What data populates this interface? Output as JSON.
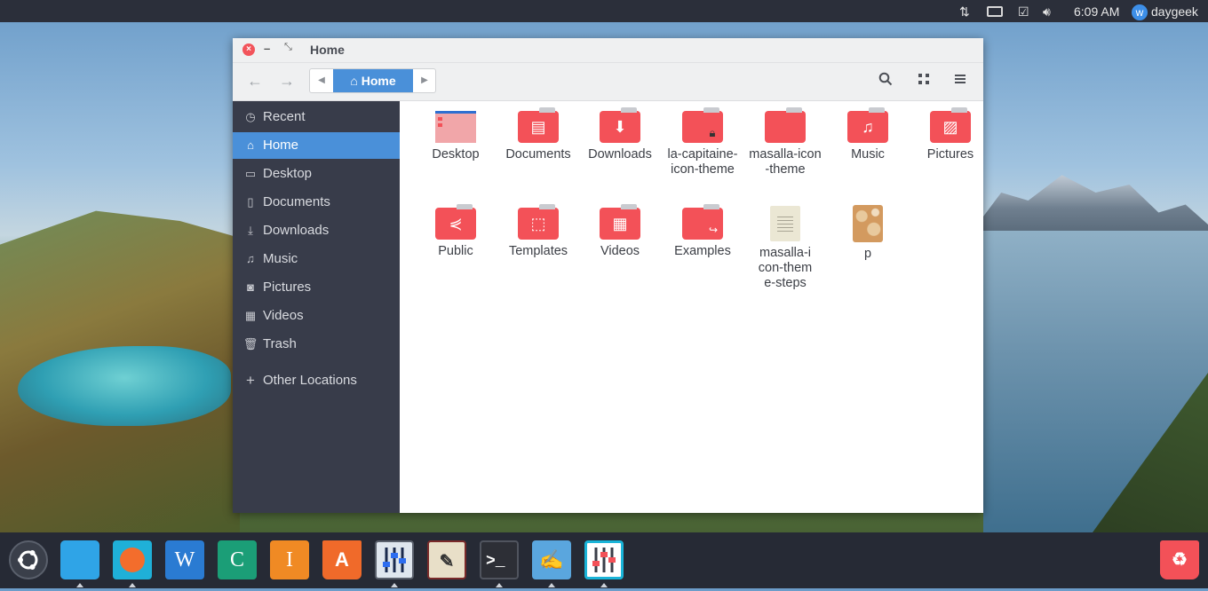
{
  "panel": {
    "time": "6:09 AM",
    "user": "daygeek",
    "icons": [
      "network-updown-icon",
      "keyboard-icon",
      "clipboard-check-icon",
      "volume-icon",
      "user-avatar-icon"
    ]
  },
  "window": {
    "title": "Home",
    "controls": [
      "close-icon",
      "minimize-icon",
      "restore-icon"
    ],
    "pathbar": {
      "current": "Home"
    }
  },
  "sidebar": {
    "items": [
      {
        "label": "Recent",
        "icon": "clock-icon"
      },
      {
        "label": "Home",
        "icon": "home-icon",
        "active": true
      },
      {
        "label": "Desktop",
        "icon": "desktop-icon"
      },
      {
        "label": "Documents",
        "icon": "document-icon"
      },
      {
        "label": "Downloads",
        "icon": "download-icon"
      },
      {
        "label": "Music",
        "icon": "music-icon"
      },
      {
        "label": "Pictures",
        "icon": "camera-icon"
      },
      {
        "label": "Videos",
        "icon": "film-icon"
      },
      {
        "label": "Trash",
        "icon": "trash-icon"
      }
    ],
    "other": {
      "label": "Other Locations",
      "icon": "plus-icon"
    }
  },
  "files": [
    {
      "name": "Desktop",
      "kind": "desktop-folder"
    },
    {
      "name": "Documents",
      "kind": "folder-documents"
    },
    {
      "name": "Downloads",
      "kind": "folder-downloads"
    },
    {
      "name": "la-capitaine-icon-theme",
      "kind": "folder-locked"
    },
    {
      "name": "masalla-icon-theme",
      "kind": "folder"
    },
    {
      "name": "Music",
      "kind": "folder-music"
    },
    {
      "name": "Pictures",
      "kind": "folder-pictures"
    },
    {
      "name": "Public",
      "kind": "folder-public"
    },
    {
      "name": "Templates",
      "kind": "folder-templates"
    },
    {
      "name": "Videos",
      "kind": "folder-videos"
    },
    {
      "name": "Examples",
      "kind": "folder-link"
    },
    {
      "name": "masalla-icon-theme-steps",
      "kind": "text-file"
    },
    {
      "name": "p",
      "kind": "image-file"
    }
  ],
  "dock": {
    "apps": [
      "ubuntu-logo-icon",
      "files-icon",
      "firefox-icon",
      "writer-icon",
      "calc-icon",
      "impress-icon",
      "software-center-icon",
      "mixer-icon",
      "drawing-icon",
      "terminal-icon",
      "text-editor-icon",
      "settings-mixer-icon"
    ],
    "trash": "trash-can-icon",
    "accent": "#f35158"
  }
}
